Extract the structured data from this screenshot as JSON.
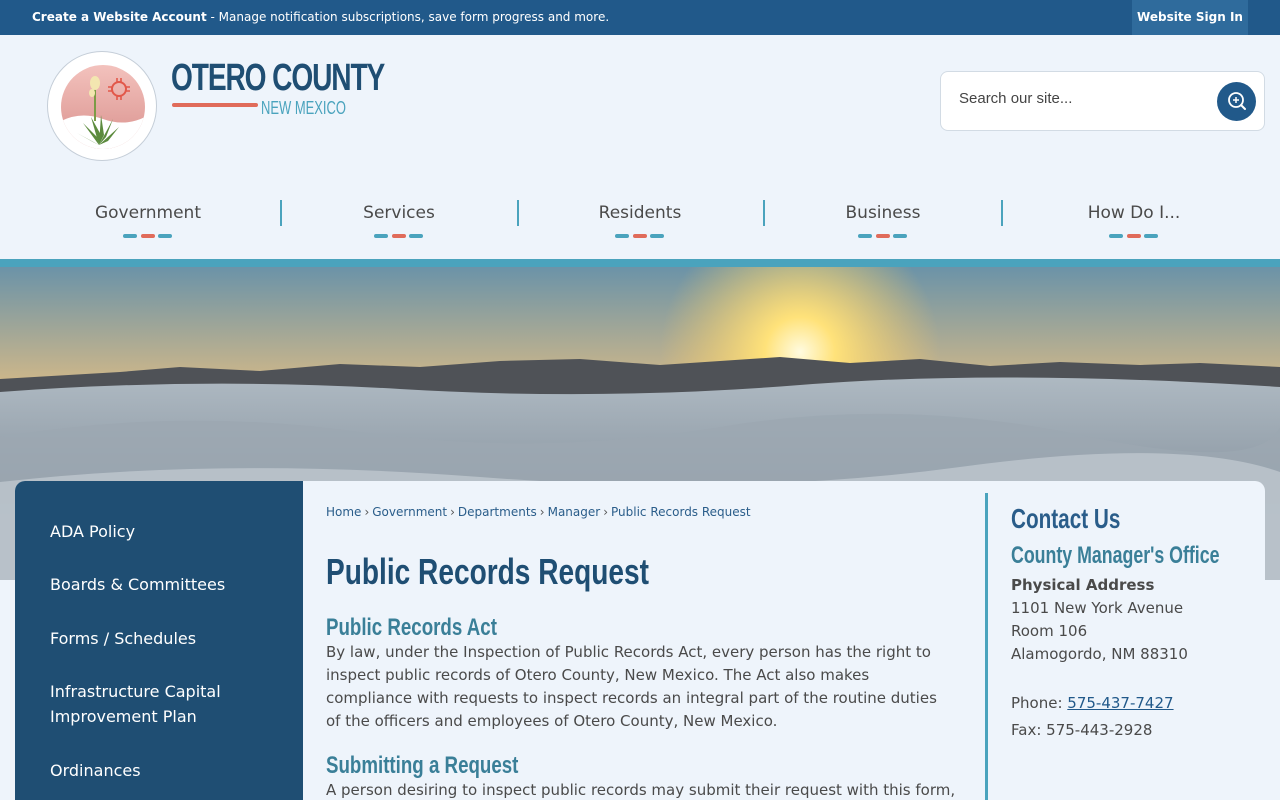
{
  "topbar": {
    "create_bold": "Create a Website Account",
    "create_rest": " - Manage notification subscriptions, save form progress and more.",
    "signin_label": "Website Sign In"
  },
  "logo": {
    "title": "OTERO COUNTY",
    "subtitle": "NEW MEXICO"
  },
  "search": {
    "placeholder": "Search our site..."
  },
  "nav": {
    "items": [
      {
        "label": "Government"
      },
      {
        "label": "Services"
      },
      {
        "label": "Residents"
      },
      {
        "label": "Business"
      },
      {
        "label": "How Do I..."
      }
    ]
  },
  "colors": {
    "primary": "#1f4e73",
    "topbar": "#21598a",
    "accent_teal": "#4aa3bd",
    "accent_coral": "#e06b5a"
  },
  "sidebar": {
    "items": [
      {
        "label": "ADA Policy"
      },
      {
        "label": "Boards & Committees"
      },
      {
        "label": "Forms / Schedules"
      },
      {
        "label": "Infrastructure Capital Improvement Plan"
      },
      {
        "label": "Ordinances"
      }
    ]
  },
  "breadcrumb": {
    "items": [
      "Home",
      "Government",
      "Departments",
      "Manager"
    ],
    "current": "Public Records Request",
    "separator": "›"
  },
  "main": {
    "title": "Public Records Request",
    "sections": [
      {
        "heading": "Public Records Act",
        "body": "By law, under the Inspection of Public Records Act, every person has the right to inspect public records of Otero County, New Mexico. The Act also makes compliance with requests to inspect records an integral part of the routine duties of the officers and employees of Otero County, New Mexico."
      },
      {
        "heading": "Submitting a Request",
        "body": "A person desiring to inspect public records may submit their request with this form,"
      }
    ]
  },
  "contact": {
    "title": "Contact Us",
    "office": "County Manager's Office",
    "address_label": "Physical Address",
    "address_line1": "1101 New York Avenue",
    "address_line2": "Room 106",
    "address_line3": "Alamogordo, NM 88310",
    "phone_label": "Phone: ",
    "phone": "575-437-7427",
    "fax_label": "Fax: ",
    "fax": "575-443-2928"
  }
}
